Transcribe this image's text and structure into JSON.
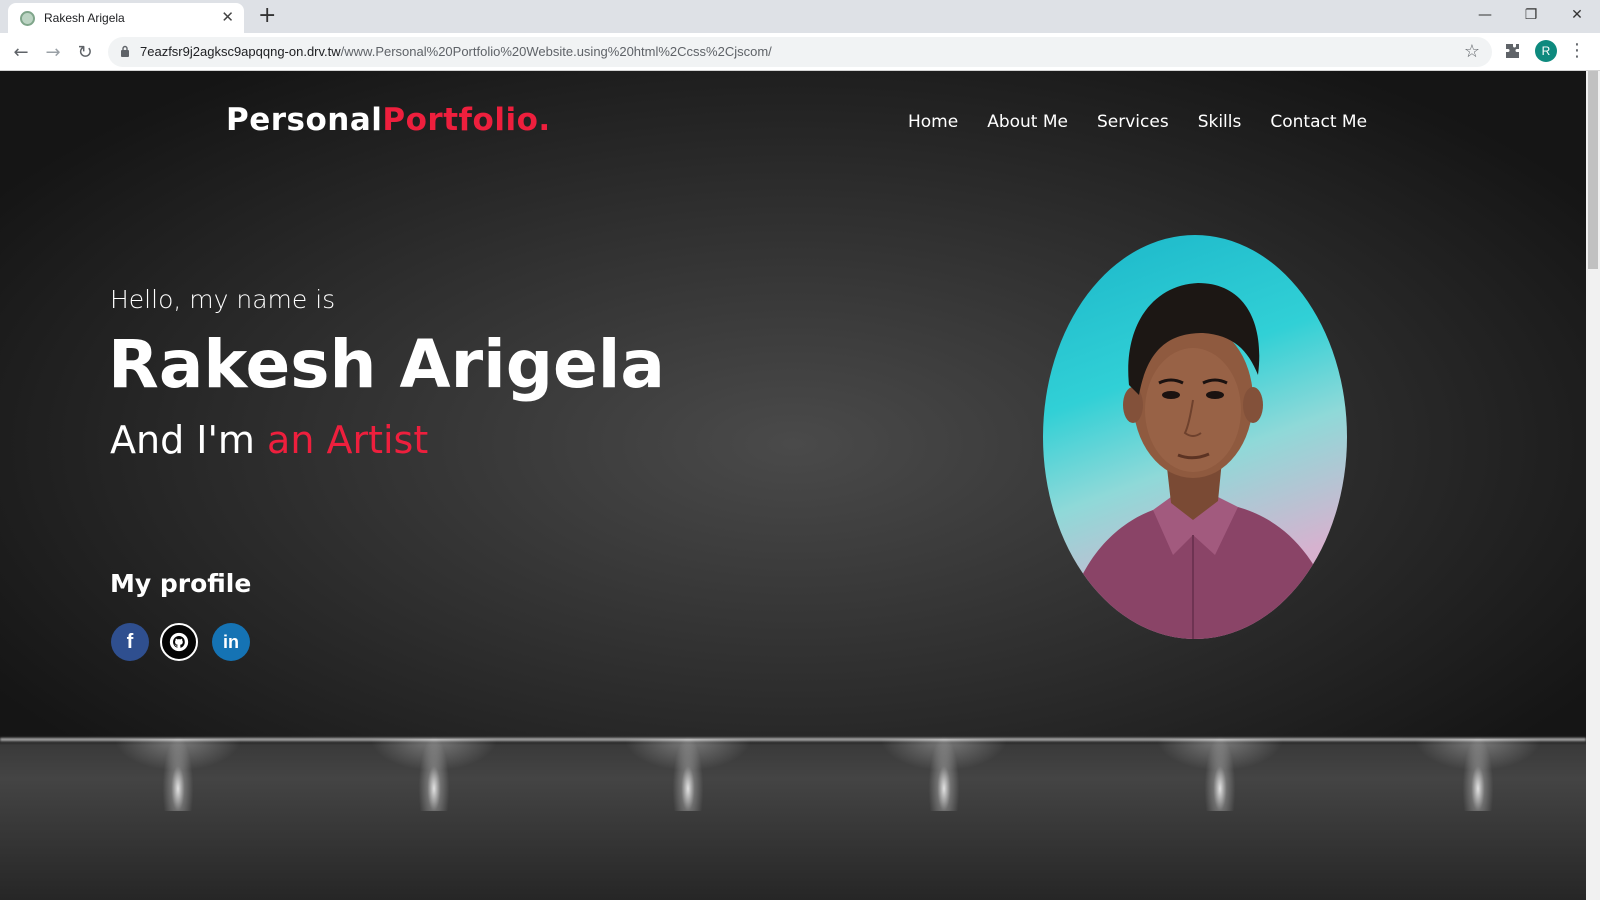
{
  "browser": {
    "tab_title": "Rakesh Arigela",
    "url_host": "7eazfsr9j2agksc9apqqng-on.drv.tw",
    "url_path": "/www.Personal%20Portfolio%20Website.using%20html%2Ccss%2Cjscom/",
    "avatar_letter": "R"
  },
  "header": {
    "brand_main": "Personal",
    "brand_accent": "Portfolio.",
    "nav": [
      "Home",
      "About Me",
      "Services",
      "Skills",
      "Contact Me"
    ]
  },
  "hero": {
    "greeting": "Hello, my name is",
    "name": "Rakesh Arigela",
    "role_prefix": "And I'm ",
    "role_accent": "an Artist",
    "profile_title": "My profile",
    "social": [
      {
        "icon": "facebook-icon",
        "glyph": "f"
      },
      {
        "icon": "github-icon",
        "glyph": ""
      },
      {
        "icon": "linkedin-icon",
        "glyph": "in"
      }
    ]
  },
  "colors": {
    "accent": "#ee1f3d",
    "facebook": "#2f4f8f",
    "linkedin": "#1573b4"
  }
}
